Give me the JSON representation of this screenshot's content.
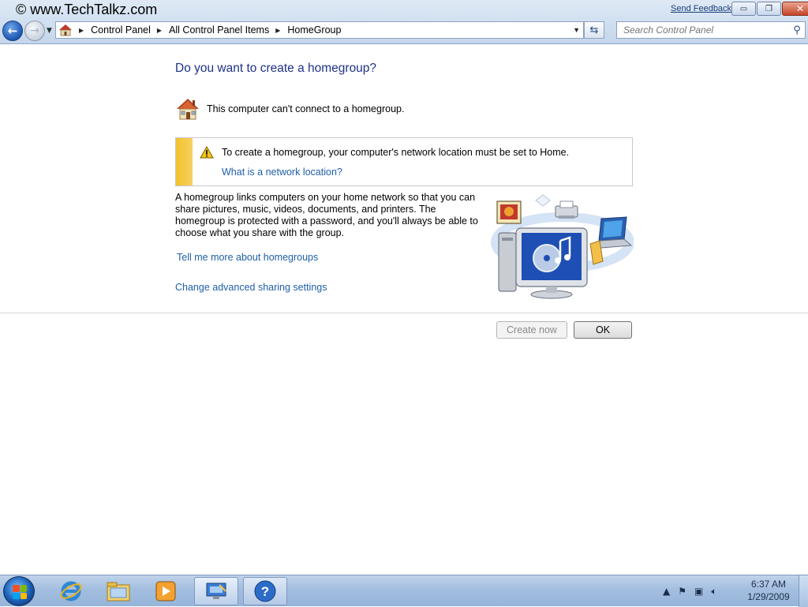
{
  "watermark": "© www.TechTalkz.com",
  "chrome": {
    "send_feedback": "Send Feedback",
    "caption": {
      "minimize": "▭",
      "restore": "❐",
      "close": "✕"
    }
  },
  "nav": {
    "back_icon": "←",
    "forward_icon": "→",
    "breadcrumb": [
      "Control Panel",
      "All Control Panel Items",
      "HomeGroup"
    ],
    "search_placeholder": "Search Control Panel"
  },
  "content": {
    "heading": "Do you want to create a homegroup?",
    "status": "This computer can't connect to a homegroup.",
    "info": {
      "message": "To create a homegroup, your computer's network location must be set to Home.",
      "link": "What is a network location?"
    },
    "description": "A homegroup links computers on your home network so that you can share pictures, music, videos, documents, and printers. The homegroup is protected with a password, and you'll always be able to choose what you share with the group.",
    "link_tell_more": "Tell me more about homegroups",
    "link_advanced": "Change advanced sharing settings"
  },
  "buttons": {
    "create_now": "Create now",
    "ok": "OK"
  },
  "taskbar": {
    "items": [
      "start-orb",
      "internet-explorer-icon",
      "windows-explorer-icon",
      "media-player-icon",
      "homegroup-icon",
      "help-icon"
    ],
    "clock_time": "6:37 AM",
    "clock_date": "1/29/2009"
  },
  "colors": {
    "heading": "#1e3287",
    "link": "#1f5fa8",
    "warning_bar": "#f3c12c"
  }
}
